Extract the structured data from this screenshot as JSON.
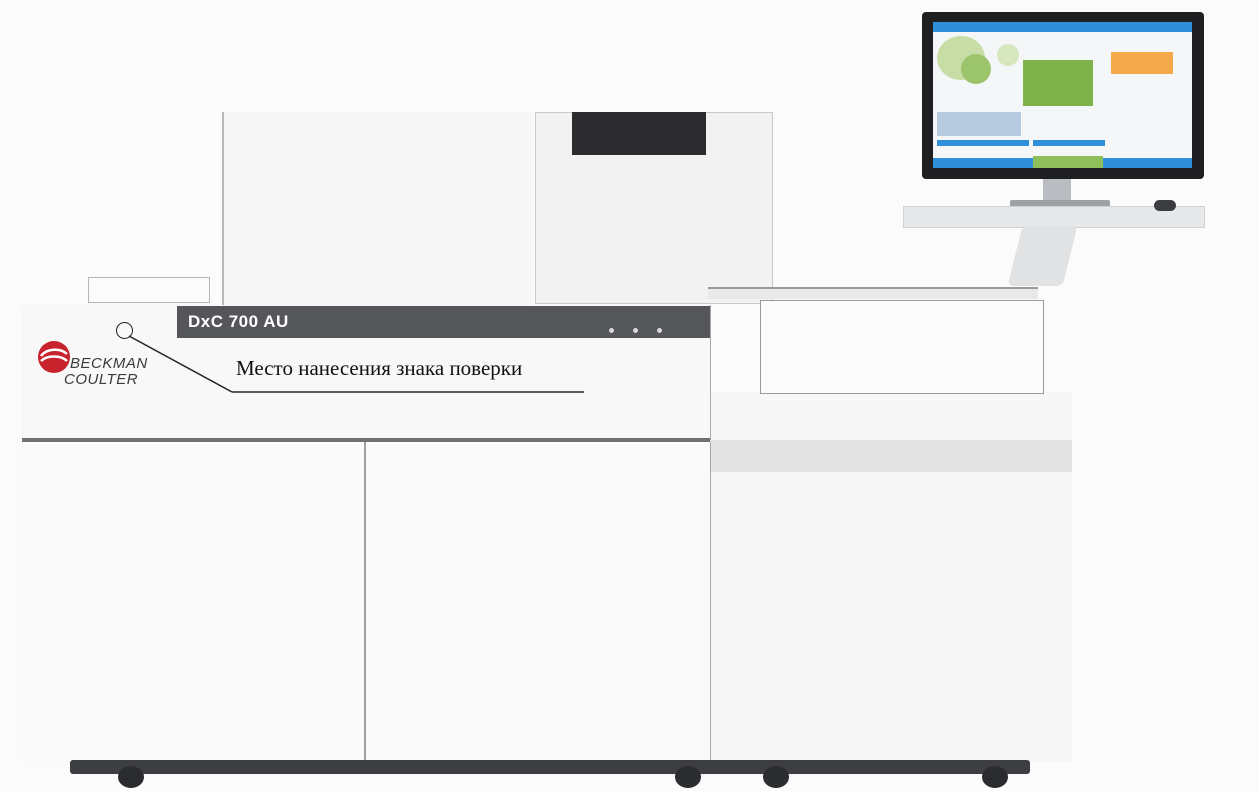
{
  "analyzer": {
    "model_label": "DxC 700 AU",
    "brand_line1": "BECKMAN",
    "brand_line2": "COULTER",
    "brand_color": "#c8222d",
    "panel_color": "#55565a"
  },
  "annotation": {
    "label": "Место нанесения знака поверки"
  },
  "monitor": {
    "screen_accent": "#2f8fd8",
    "highlight": "#f6a94a"
  }
}
